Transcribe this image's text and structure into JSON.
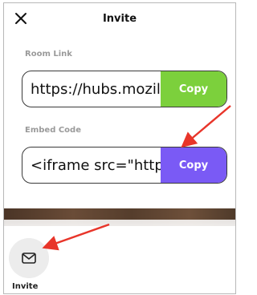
{
  "dialog": {
    "title": "Invite",
    "room_link": {
      "label": "Room Link",
      "value": "https://hubs.mozil",
      "copy_label": "Copy"
    },
    "embed_code": {
      "label": "Embed Code",
      "value": "<iframe src=\"https",
      "copy_label": "Copy"
    }
  },
  "toolbar": {
    "invite_label": "Invite",
    "invite_icon": "envelope-icon"
  },
  "colors": {
    "copy_room_link": "#7cd03c",
    "copy_embed_code": "#7a5af5",
    "annotation_arrow": "#e8352a"
  }
}
